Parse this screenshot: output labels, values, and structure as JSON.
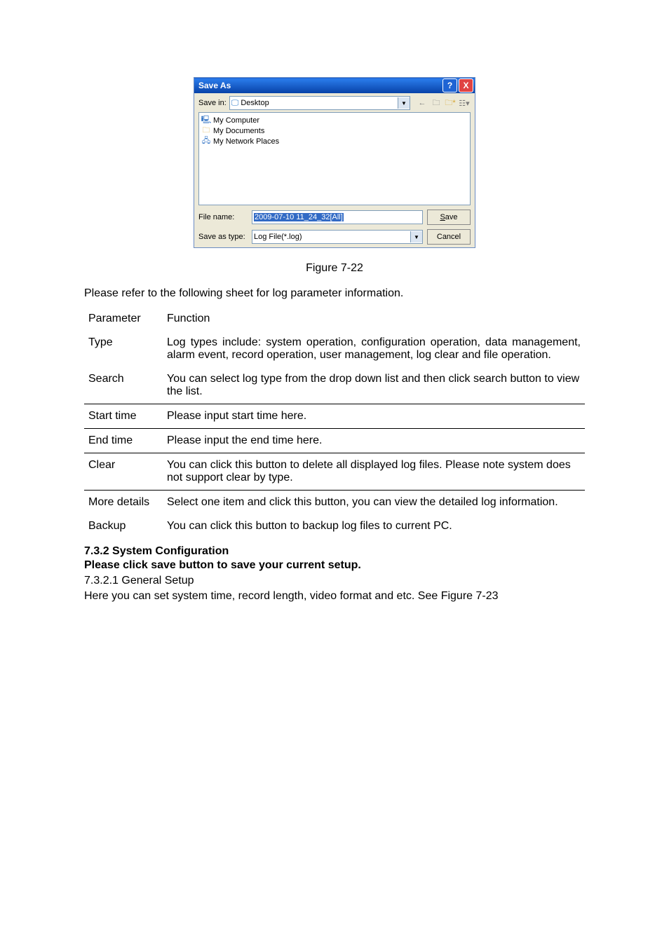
{
  "dialog": {
    "title": "Save As",
    "save_in_label": "Save in:",
    "save_in_value": "Desktop",
    "items": [
      "My Computer",
      "My Documents",
      "My Network Places"
    ],
    "file_name_label": "File name:",
    "file_name_value": "2009-07-10 11_24_32[All]",
    "save_as_type_label": "Save as type:",
    "save_as_type_value": "Log File(*.log)",
    "save_btn": "Save",
    "save_btn_ul": "S",
    "save_btn_rest": "ave",
    "cancel_btn": "Cancel"
  },
  "figure_caption": "Figure 7-22",
  "intro": "Please refer to the following sheet for log parameter information.",
  "table": {
    "header": {
      "p": "Parameter",
      "f": "Function"
    },
    "rows": [
      {
        "p": "Type",
        "f": "Log types include: system operation, configuration operation, data management, alarm event, record operation, user management, log clear and file operation."
      },
      {
        "p": "Search",
        "f": "You can select log type from the drop down list and then click search button to view the list."
      },
      {
        "p": "Start time",
        "f": "Please input start time here."
      },
      {
        "p": "End time",
        "f": "Please input the end time here."
      },
      {
        "p": "Clear",
        "f": "You can click this button to delete all displayed log files.   Please note system does not support clear by type."
      },
      {
        "p": "More details",
        "f": "Select one item and click this button, you can view the detailed log information."
      },
      {
        "p": "Backup",
        "f": "You can click this button to backup log files to current PC."
      }
    ]
  },
  "sec1": "7.3.2  System Configuration",
  "sec1_note": "Please click save button to save your current setup.",
  "sec2": "7.3.2.1  General Setup",
  "sec2_text": "Here you can set system time, record length, video format and etc. See Figure 7-23"
}
